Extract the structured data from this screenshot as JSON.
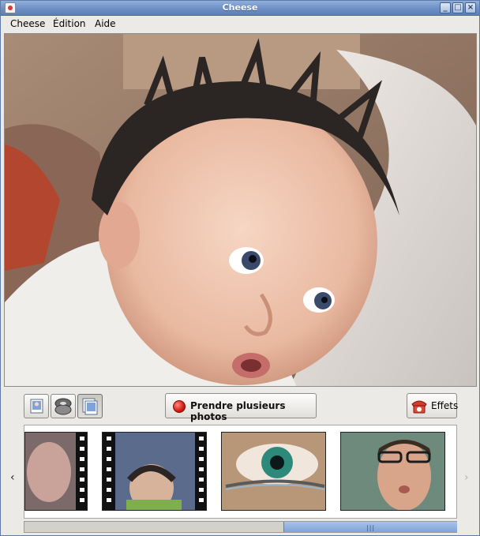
{
  "window": {
    "title": "Cheese"
  },
  "menu": [
    {
      "label": "Cheese"
    },
    {
      "label": "Édition"
    },
    {
      "label": "Aide"
    }
  ],
  "toolbar": {
    "modes": [
      "photo-mode",
      "video-mode",
      "burst-mode"
    ],
    "active_mode": "burst-mode",
    "capture_label": "Prendre plusieurs photos",
    "effects_label": "Effets"
  },
  "thumbnails": [
    {
      "name": "thumb-1",
      "kind": "video"
    },
    {
      "name": "thumb-2",
      "kind": "video"
    },
    {
      "name": "thumb-3",
      "kind": "photo"
    },
    {
      "name": "thumb-4",
      "kind": "photo"
    }
  ],
  "scroll": {
    "position_fraction": 0.6
  },
  "colors": {
    "titlebar": "#6d8fc4",
    "accent": "#7fa3d8",
    "record": "#d31a10"
  }
}
